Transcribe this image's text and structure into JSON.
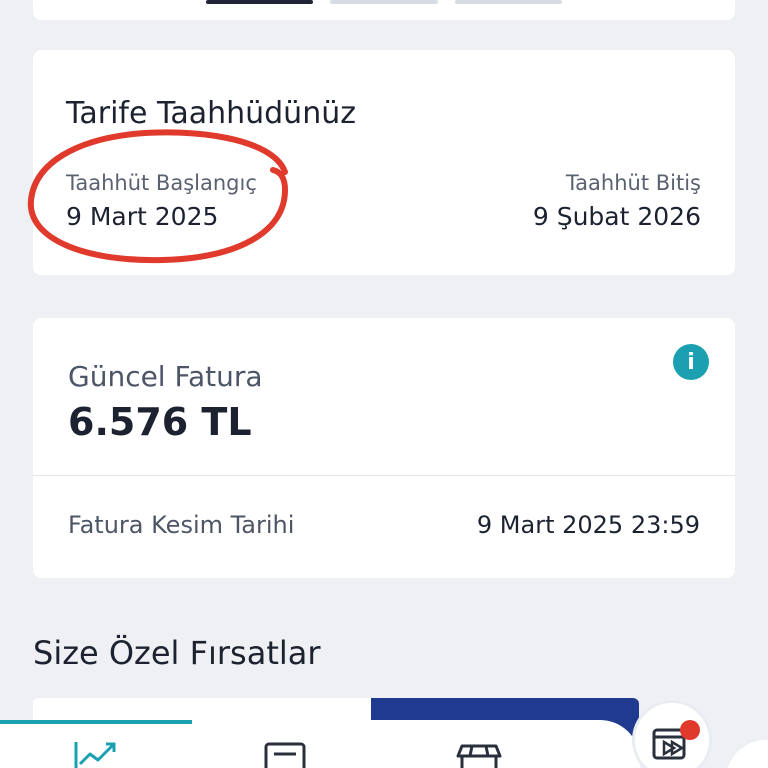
{
  "tariff": {
    "title": "Tarife Taahhüdünüz",
    "start_label": "Taahhüt Başlangıç",
    "start_value": "9 Mart 2025",
    "end_label": "Taahhüt Bitiş",
    "end_value": "9 Şubat 2026"
  },
  "invoice": {
    "label": "Güncel Fatura",
    "amount": "6.576 TL",
    "info_icon": "info-icon",
    "cutoff_label": "Fatura Kesim Tarihi",
    "cutoff_value": "9 Mart 2025 23:59"
  },
  "offers": {
    "title": "Size Özel Fırsatlar"
  },
  "bottom_nav": {
    "items": [
      {
        "icon": "chart-icon",
        "active": true
      },
      {
        "icon": "invoice-icon",
        "active": false
      },
      {
        "icon": "shop-icon",
        "active": false
      }
    ]
  },
  "colors": {
    "accent": "#1aa0b0",
    "annotation_red": "#e03a2c",
    "background": "#eef0f4",
    "text": "#1c2230"
  }
}
